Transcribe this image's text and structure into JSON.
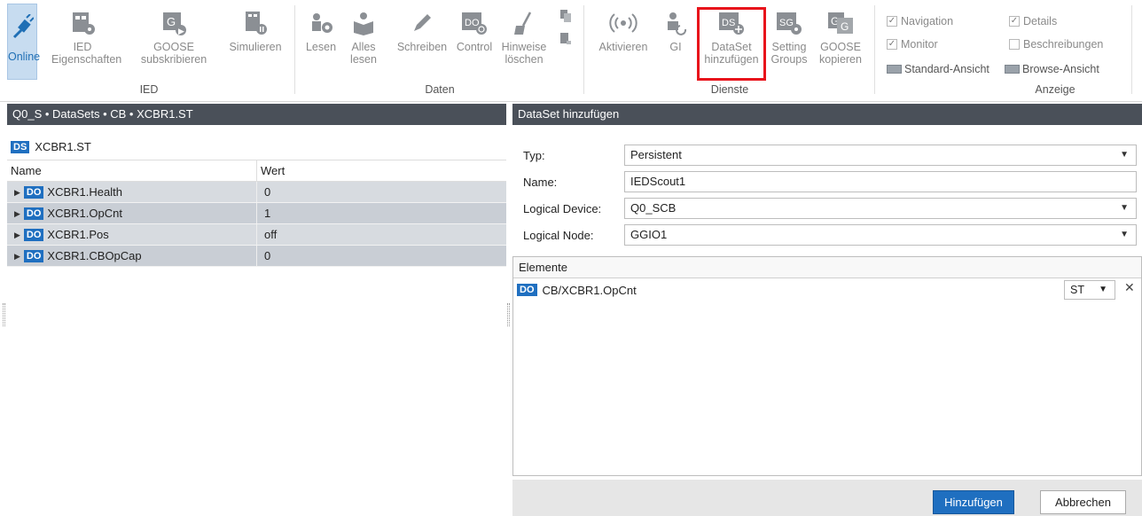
{
  "ribbon": {
    "ied": {
      "online": "Online",
      "ied_props": "IED\nEigenschaften",
      "goose_sub": "GOOSE\nsubskribieren",
      "simulate": "Simulieren",
      "group": "IED"
    },
    "daten": {
      "read": "Lesen",
      "read_all": "Alles\nlesen",
      "write": "Schreiben",
      "control": "Control",
      "clear_hints": "Hinweise\nlöschen",
      "group": "Daten"
    },
    "dienste": {
      "activate": "Aktivieren",
      "gi": "GI",
      "dataset_add": "DataSet\nhinzufügen",
      "setting_groups": "Setting\nGroups",
      "goose_copy": "GOOSE\nkopieren",
      "group": "Dienste",
      "icon_text_ds": "DS",
      "icon_text_sg": "SG",
      "icon_text_do": "DO",
      "icon_text_g": "G"
    },
    "anzeige": {
      "navigation": "Navigation",
      "details": "Details",
      "monitor": "Monitor",
      "beschreibungen": "Beschreibungen",
      "standard_view": "Standard-Ansicht",
      "browse_view": "Browse-Ansicht",
      "group": "Anzeige",
      "check_mark": "✓"
    }
  },
  "left": {
    "breadcrumb": "Q0_S • DataSets • CB • XCBR1.ST",
    "ds_badge": "DS",
    "ds_title": "XCBR1.ST",
    "col_name": "Name",
    "col_value": "Wert",
    "do_badge": "DO",
    "rows": [
      {
        "name": "XCBR1.Health",
        "value": "0"
      },
      {
        "name": "XCBR1.OpCnt",
        "value": "1"
      },
      {
        "name": "XCBR1.Pos",
        "value": "off"
      },
      {
        "name": "XCBR1.CBOpCap",
        "value": "0"
      }
    ]
  },
  "right": {
    "title": "DataSet hinzufügen",
    "typ_label": "Typ:",
    "typ_value": "Persistent",
    "name_label": "Name:",
    "name_value": "IEDScout1",
    "ld_label": "Logical Device:",
    "ld_value": "Q0_SCB",
    "ln_label": "Logical Node:",
    "ln_value": "GGIO1",
    "elements_label": "Elemente",
    "element": {
      "badge": "DO",
      "path": "CB/XCBR1.OpCnt",
      "fc": "ST"
    },
    "add_button": "Hinzufügen",
    "cancel_button": "Abbrechen"
  },
  "colors": {
    "accent": "#1f6fc0",
    "header": "#4a5059",
    "highlight": "#e8141b"
  }
}
